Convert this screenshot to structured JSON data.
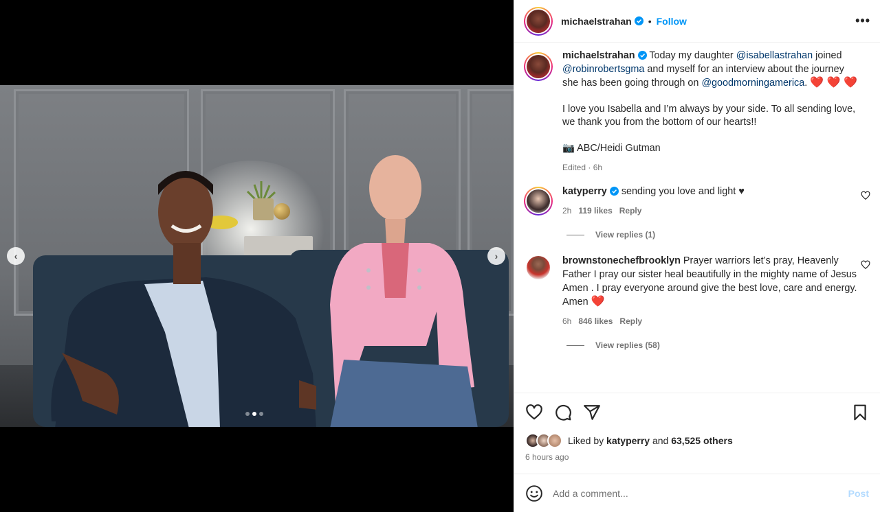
{
  "header": {
    "username": "michaelstrahan",
    "separator": "•",
    "follow_label": "Follow",
    "more_label": "•••"
  },
  "caption": {
    "username": "michaelstrahan",
    "text_1": "Today my daughter",
    "mention_1": "@isabellastrahan",
    "text_2": "joined",
    "mention_2": "@robinrobertsgma",
    "text_3": "and myself for an interview about the journey she has been going through on",
    "mention_3": "@goodmorningamerica",
    "text_4": ".",
    "hearts": "❤️ ❤️ ❤️",
    "paragraph_2": "I love you Isabella and I’m always by your side. To all sending love, we thank you from the bottom of our hearts!!",
    "credit": "📷 ABC/Heidi Gutman",
    "edited": "Edited · 6h"
  },
  "comments": [
    {
      "username": "katyperry",
      "text": "sending you love and light ♥",
      "time": "2h",
      "likes": "119 likes",
      "reply_label": "Reply",
      "view_replies": "View replies (1)"
    },
    {
      "username": "brownstonechefbrooklyn",
      "text": "Prayer warriors let’s pray, Heavenly Father I pray our sister heal beautifully in the mighty name of Jesus Amen . I pray everyone around give the best love, care and energy. Amen",
      "heart": "❤️",
      "time": "6h",
      "likes": "846 likes",
      "reply_label": "Reply",
      "view_replies": "View replies (58)"
    }
  ],
  "likes": {
    "prefix": "Liked by",
    "user": "katyperry",
    "and": "and",
    "others": "63,525 others",
    "time_ago": "6 hours ago"
  },
  "add_comment": {
    "placeholder": "Add a comment...",
    "post_label": "Post"
  },
  "carousel": {
    "prev": "‹",
    "next": "›",
    "current_index": 2,
    "total": 3
  },
  "colors": {
    "accent": "#0095f6",
    "link": "#00376b",
    "muted": "#737373",
    "heart": "#e0101c"
  }
}
